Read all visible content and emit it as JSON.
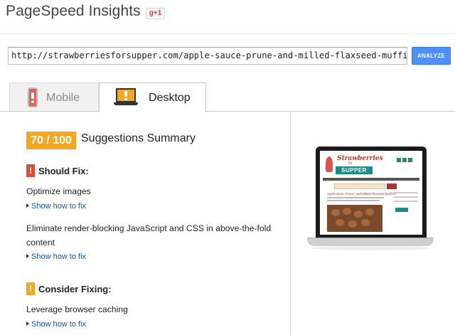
{
  "header": {
    "app_title": "PageSpeed Insights",
    "gplus_label": "g+1"
  },
  "url_bar": {
    "value": "http://strawberriesforsupper.com/apple-sauce-prune-and-milled-flaxseed-muffins/",
    "analyze_label": "ANALYZE"
  },
  "tabs": [
    {
      "label": "Mobile",
      "active": false,
      "icon": "mobile-warning-icon"
    },
    {
      "label": "Desktop",
      "active": true,
      "icon": "desktop-warning-icon"
    }
  ],
  "summary": {
    "score": "70 / 100",
    "title": "Suggestions Summary"
  },
  "sections": [
    {
      "icon": "exclamation-icon",
      "title": "Should Fix:",
      "color": "#dd4b39",
      "rules": [
        {
          "text": "Optimize images",
          "link": "Show how to fix"
        },
        {
          "text": "Eliminate render-blocking JavaScript and CSS in above-the-fold content",
          "link": "Show how to fix"
        }
      ]
    },
    {
      "icon": "exclamation-icon",
      "title": "Consider Fixing:",
      "color": "#f5a623",
      "rules": [
        {
          "text": "Leverage browser caching",
          "link": "Show how to fix"
        }
      ]
    }
  ],
  "preview": {
    "site_name_top": "Strawberries",
    "site_name_mid": "for",
    "site_name_bottom": "SUPPER",
    "post_title": "Applesauce, Prune, and Milled Flaxseed Muffins"
  },
  "colors": {
    "score_badge": "#f5a623",
    "should_fix": "#dd4b39",
    "consider_fixing": "#f5a623",
    "link": "#1155cc",
    "analyze_button": "#4d90fe"
  }
}
